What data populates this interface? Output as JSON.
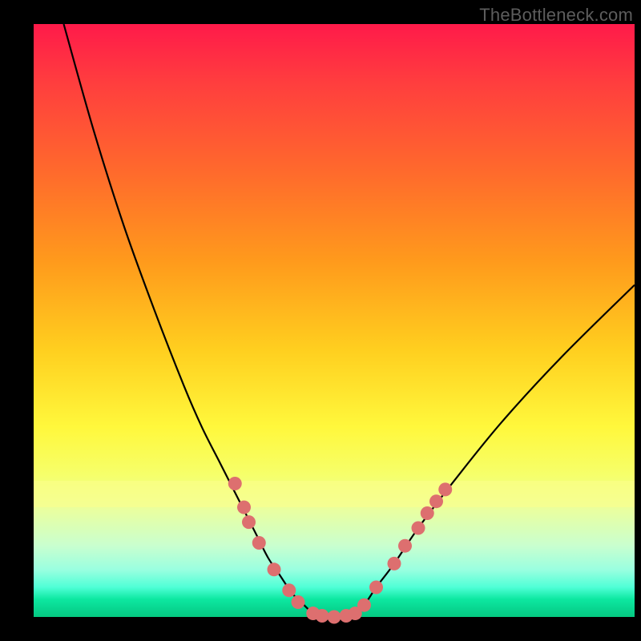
{
  "watermark": "TheBottleneck.com",
  "chart_data": {
    "type": "line",
    "title": "",
    "xlabel": "",
    "ylabel": "",
    "xlim": [
      0,
      100
    ],
    "ylim": [
      0,
      100
    ],
    "curve_left": {
      "name": "left-branch",
      "x": [
        5,
        10,
        15,
        20,
        25,
        28,
        31,
        33,
        35,
        37,
        39,
        41,
        43,
        45,
        46,
        47
      ],
      "y": [
        100,
        82,
        66,
        52,
        39,
        32,
        26,
        22,
        18,
        14,
        10,
        7,
        4,
        2,
        1,
        0
      ]
    },
    "curve_right": {
      "name": "right-branch",
      "x": [
        53,
        55,
        57,
        60,
        64,
        70,
        78,
        88,
        100
      ],
      "y": [
        0,
        2,
        5,
        9,
        15,
        23,
        33,
        44,
        56
      ]
    },
    "flat": {
      "name": "min-segment",
      "x": [
        47,
        48,
        49,
        50,
        51,
        52,
        53
      ],
      "y": [
        0,
        0,
        0,
        0,
        0,
        0,
        0
      ]
    },
    "markers": {
      "name": "highlighted-points",
      "points": [
        {
          "x": 33.5,
          "y": 22.5
        },
        {
          "x": 35.0,
          "y": 18.5
        },
        {
          "x": 35.8,
          "y": 16.0
        },
        {
          "x": 37.5,
          "y": 12.5
        },
        {
          "x": 40.0,
          "y": 8.0
        },
        {
          "x": 42.5,
          "y": 4.5
        },
        {
          "x": 44.0,
          "y": 2.5
        },
        {
          "x": 46.5,
          "y": 0.6
        },
        {
          "x": 48.0,
          "y": 0.2
        },
        {
          "x": 50.0,
          "y": 0.0
        },
        {
          "x": 52.0,
          "y": 0.2
        },
        {
          "x": 53.5,
          "y": 0.6
        },
        {
          "x": 55.0,
          "y": 2.0
        },
        {
          "x": 57.0,
          "y": 5.0
        },
        {
          "x": 60.0,
          "y": 9.0
        },
        {
          "x": 61.8,
          "y": 12.0
        },
        {
          "x": 64.0,
          "y": 15.0
        },
        {
          "x": 65.5,
          "y": 17.5
        },
        {
          "x": 67.0,
          "y": 19.5
        },
        {
          "x": 68.5,
          "y": 21.5
        }
      ]
    },
    "marker_color": "#dd6f6f",
    "curve_color": "#000000",
    "gradient_top": "#ff1a4a",
    "gradient_bottom": "#05c981"
  }
}
